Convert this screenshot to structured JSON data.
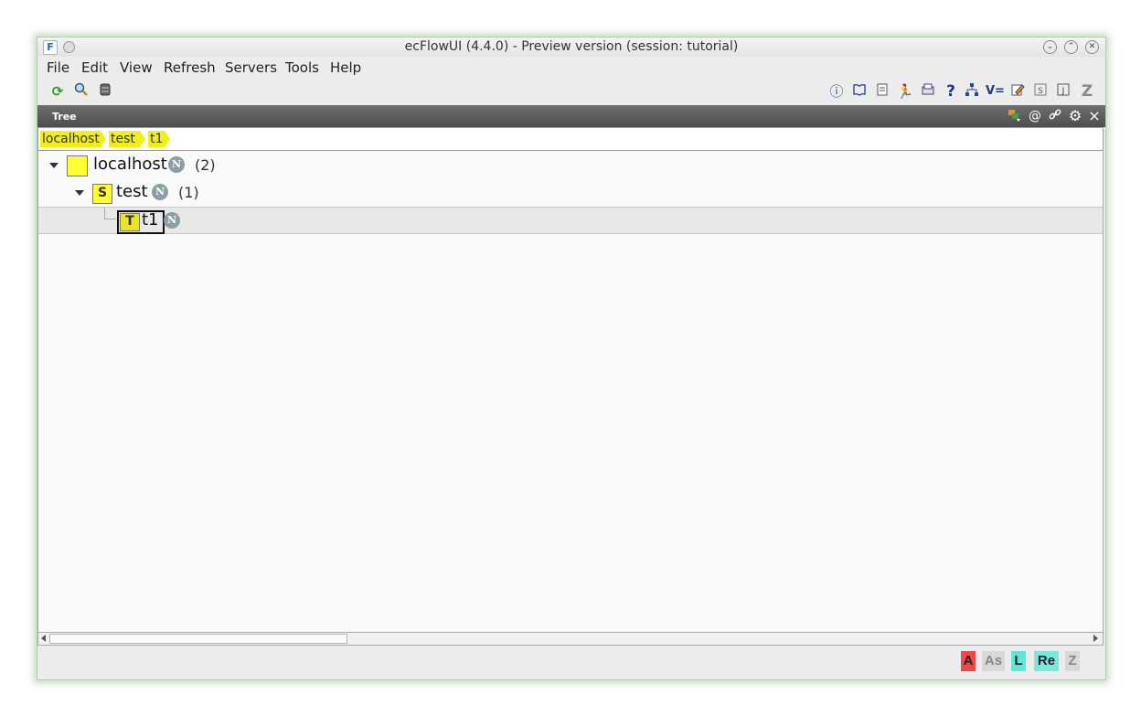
{
  "window": {
    "app_icon": "F",
    "title": "ecFlowUI (4.4.0)  -  Preview version (session: tutorial)"
  },
  "menu": [
    "File",
    "Edit",
    "View",
    "Refresh",
    "Servers",
    "Tools",
    "Help"
  ],
  "toolbar_left_icons": [
    "refresh-icon",
    "search-icon",
    "server-icon"
  ],
  "toolbar_right_icons": [
    "info-icon",
    "book-icon",
    "script-icon",
    "run-icon",
    "output-icon",
    "help-icon",
    "tree-icon",
    "variables-icon",
    "edit-icon",
    "script-file-icon",
    "job-icon",
    "zombie-icon"
  ],
  "toolbar_right_text": {
    "help": "?",
    "variables": "V=",
    "zombie": "Z"
  },
  "panel": {
    "title": "Tree",
    "icons": [
      "filter-icon",
      "at-icon",
      "link-icon",
      "gear-icon",
      "close-icon"
    ],
    "at_glyph": "@",
    "close_glyph": "×"
  },
  "breadcrumb": [
    "localhost",
    "test",
    "t1"
  ],
  "tree": {
    "server": {
      "name": "localhost",
      "badge": "N",
      "count": "(2)"
    },
    "suite": {
      "letter": "S",
      "name": "test",
      "badge": "N",
      "count": "(1)"
    },
    "task": {
      "letter": "T",
      "name": "t1",
      "badge": "N"
    }
  },
  "status_badges": [
    {
      "label": "A",
      "color": "#f04848",
      "text_color": "#222"
    },
    {
      "label": "As",
      "color": "#d8d8d8",
      "text_color": "#888"
    },
    {
      "label": "L",
      "color": "#5fe8d8",
      "text_color": "#222"
    },
    {
      "label": "Re",
      "color": "#7ae8dc",
      "text_color": "#222"
    },
    {
      "label": "Z",
      "color": "#d8d8d8",
      "text_color": "#888"
    }
  ],
  "colors": {
    "node_yellow": "#ffff33",
    "crumb_yellow": "#f2ee1a",
    "badge_grey": "#8e9ea5"
  }
}
